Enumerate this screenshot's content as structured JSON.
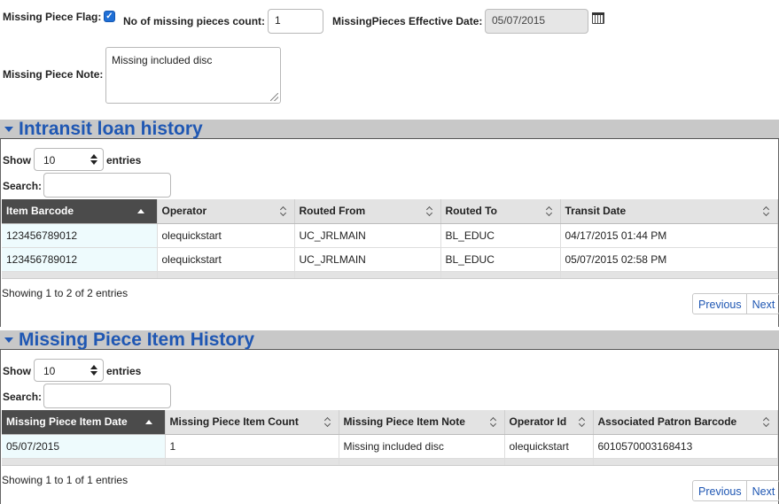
{
  "form": {
    "missing_flag_label": "Missing Piece Flag:",
    "missing_flag_checked": true,
    "count_label": "No of missing pieces count:",
    "count_value": "1",
    "effective_date_label": "MissingPieces Effective Date:",
    "effective_date_value": "05/07/2015",
    "note_label": "Missing Piece Note:",
    "note_value": "Missing included disc"
  },
  "intransit": {
    "title": "Intransit loan history",
    "show_label": "Show",
    "entries_value": "10",
    "entries_label": "entries",
    "search_label": "Search:",
    "search_value": "",
    "columns": [
      "Item Barcode",
      "Operator",
      "Routed From",
      "Routed To",
      "Transit Date"
    ],
    "rows": [
      [
        "123456789012",
        "olequickstart",
        "UC_JRLMAIN",
        "BL_EDUC",
        "04/17/2015 01:44 PM"
      ],
      [
        "123456789012",
        "olequickstart",
        "UC_JRLMAIN",
        "BL_EDUC",
        "05/07/2015 02:58 PM"
      ]
    ],
    "info": "Showing 1 to 2 of 2 entries",
    "previous": "Previous",
    "next": "Next"
  },
  "missing_history": {
    "title": "Missing Piece Item History",
    "show_label": "Show",
    "entries_value": "10",
    "entries_label": "entries",
    "search_label": "Search:",
    "search_value": "",
    "columns": [
      "Missing Piece Item Date",
      "Missing Piece Item Count",
      "Missing Piece Item Note",
      "Operator Id",
      "Associated Patron Barcode"
    ],
    "rows": [
      [
        "05/07/2015",
        "1",
        "Missing included disc",
        "olequickstart",
        "6010570003168413"
      ]
    ],
    "info": "Showing 1 to 1 of 1 entries",
    "previous": "Previous",
    "next": "Next"
  },
  "colors": {
    "section_title": "#1f57b3",
    "sorted_header": "#4b4b4b",
    "checkbox": "#1f6fd6"
  }
}
